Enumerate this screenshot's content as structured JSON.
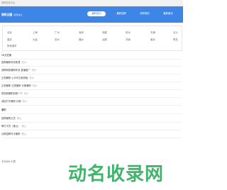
{
  "topbar": {
    "text": "网络科技平台"
  },
  "brand": {
    "title": "兼职达圈",
    "subtitle": "招聘信息"
  },
  "nav": [
    "兼职首页",
    "兼职招聘",
    "求职简历",
    "兼职黄页"
  ],
  "cities": [
    [
      "北京",
      "上海",
      "广州",
      "深圳",
      "成都",
      "杭州",
      "天津",
      "长沙"
    ],
    [
      "重庆",
      "大连",
      "苏州",
      "福州",
      "合肥",
      "济南",
      "南京",
      "青岛"
    ],
    [
      "所有城市"
    ]
  ],
  "rows": [
    {
      "text": "29元兑换",
      "tag": ""
    },
    {
      "text": "招聘兼职商务助理",
      "tag": "杭州"
    },
    {
      "text": "诚聘网络兼职商务 直播推广",
      "tag": "杭州"
    },
    {
      "text": "正规兼职 公众号文案排版",
      "tag": "杭州"
    },
    {
      "text": "正规兼职 正规兼职 长期兼职",
      "tag": "杭州"
    },
    {
      "text": "短视频兼职剪辑一个",
      "tag": "杭州"
    },
    {
      "text": "诚招打字兼职 长期",
      "tag": "杭州"
    },
    {
      "text": "兼职",
      "tag": ""
    },
    {
      "text": "招聘兼职文员",
      "tag": "佛山"
    },
    {
      "text": "聘打字员（佛山）",
      "tag": "佛山"
    },
    {
      "text": "长期招聘写手兼职",
      "tag": "佛山"
    }
  ],
  "footer": {
    "text": "©2024 人员"
  },
  "watermark": {
    "text": "动名收录网"
  },
  "colors": {
    "accent": "#3e86e6",
    "watermark_green": "#2dac5c"
  }
}
